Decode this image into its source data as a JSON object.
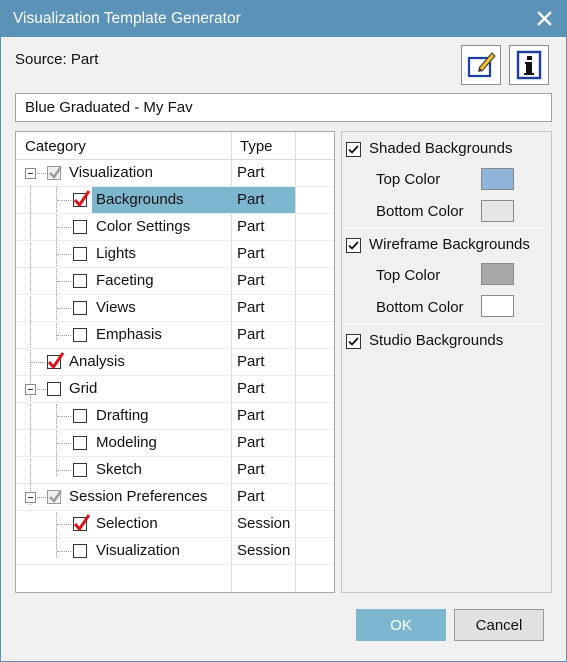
{
  "window": {
    "title": "Visualization Template Generator"
  },
  "source": {
    "label": "Source: Part"
  },
  "template_name": {
    "value": "Blue Graduated - My Fav"
  },
  "tree": {
    "headers": {
      "category": "Category",
      "type": "Type"
    },
    "rows": [
      {
        "label": "Visualization",
        "type": "Part",
        "state": "grey-checked"
      },
      {
        "label": "Backgrounds",
        "type": "Part",
        "state": "checked"
      },
      {
        "label": "Color Settings",
        "type": "Part",
        "state": "unchecked"
      },
      {
        "label": "Lights",
        "type": "Part",
        "state": "unchecked"
      },
      {
        "label": "Faceting",
        "type": "Part",
        "state": "unchecked"
      },
      {
        "label": "Views",
        "type": "Part",
        "state": "unchecked"
      },
      {
        "label": "Emphasis",
        "type": "Part",
        "state": "unchecked"
      },
      {
        "label": "Analysis",
        "type": "Part",
        "state": "checked"
      },
      {
        "label": "Grid",
        "type": "Part",
        "state": "unchecked"
      },
      {
        "label": "Drafting",
        "type": "Part",
        "state": "unchecked"
      },
      {
        "label": "Modeling",
        "type": "Part",
        "state": "unchecked"
      },
      {
        "label": "Sketch",
        "type": "Part",
        "state": "unchecked"
      },
      {
        "label": "Session Preferences",
        "type": "Part",
        "state": "grey-checked"
      },
      {
        "label": "Selection",
        "type": "Session",
        "state": "checked"
      },
      {
        "label": "Visualization",
        "type": "Session",
        "state": "unchecked"
      }
    ]
  },
  "options": {
    "shaded": {
      "label": "Shaded Backgrounds",
      "checked": true,
      "top_label": "Top Color",
      "top_color": "#8fb4d9",
      "bottom_label": "Bottom Color",
      "bottom_color": "#e6e6e6"
    },
    "wireframe": {
      "label": "Wireframe Backgrounds",
      "checked": true,
      "top_label": "Top Color",
      "top_color": "#a8a8a8",
      "bottom_label": "Bottom Color",
      "bottom_color": "#ffffff"
    },
    "studio": {
      "label": "Studio Backgrounds",
      "checked": true
    }
  },
  "buttons": {
    "ok": "OK",
    "cancel": "Cancel"
  },
  "colors": {
    "accent": "#5a92b8",
    "selection": "#7db7cf",
    "check_red": "#d9141e"
  },
  "icons": {
    "close": "close-icon",
    "edit": "edit-icon",
    "info": "info-icon"
  }
}
